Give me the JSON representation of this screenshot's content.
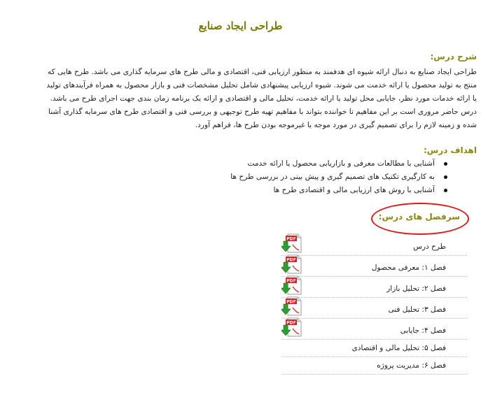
{
  "page": {
    "title": "طراحی ایجاد صنایع"
  },
  "description": {
    "heading": "شرح درس:",
    "lines": [
      "طراحی ایجاد صنایع به دنبال ارائه شیوه ای هدفمند به منظور ارزیابی فنی، اقتصادی و مالی طرح های سرمایه گذاری می باشد. طرح هایی که",
      "منتج به تولید محصول یا ارائه خدمت می شوند. شیوه ارزیابی پیشنهادی شامل تحلیل مشخصات فنی و بازار محصول به همراه فرآیندهای تولید",
      "یا ارائه خدمات مورد نظر، جایابی محل تولید یا ارائه خدمت، تحلیل مالی و اقتصادی و ارائه یک برنامه زمان بندی جهت اجرای طرح می باشد.",
      "درس حاضر مروری است بر این مفاهیم تا خواننده بتواند با مفاهیم تهیه طرح توجیهی و بررسی فنی و اقتصادی طرح های سرمایه گذاری آشنا",
      "شده و زمینه لازم را برای تصمیم گیری در مورد موجه یا غیرموجه بودن طرح ها، فراهم آورد."
    ]
  },
  "objectives": {
    "heading": "اهداف درس:",
    "items": [
      "آشنایی با مطالعات معرفی و بازاریابی محصول یا ارائه خدمت",
      "به کارگیری تکنیک های تصمیم گیری و پیش بینی در بررسی طرح ها",
      "آشنایی با روش های ارزیابی مالی و اقتصادی طرح ها"
    ]
  },
  "syllabus": {
    "heading": "سرفصل های درس:",
    "items": [
      {
        "label": "طرح درس",
        "icon": "pdf-download-icon"
      },
      {
        "label": "فصل ۱: معرفی محصول",
        "icon": "pdf-download-icon"
      },
      {
        "label": "فصل ۲: تحلیل بازار",
        "icon": "pdf-download-icon"
      },
      {
        "label": "فصل ۳: تحلیل فنی",
        "icon": "pdf-download-icon"
      },
      {
        "label": "فصل ۴: جایابی",
        "icon": "pdf-download-icon"
      },
      {
        "label": "فصل ۵: تحلیل مالی و اقتصادی",
        "icon": null
      },
      {
        "label": "فصل ۶: مدیریت پروژه",
        "icon": null
      }
    ]
  },
  "colors": {
    "heading": "#8a8a10",
    "title": "#7a7a06",
    "annotation_circle": "#e01818",
    "pdf_red": "#d42020",
    "arrow_green": "#2e9e2e"
  }
}
